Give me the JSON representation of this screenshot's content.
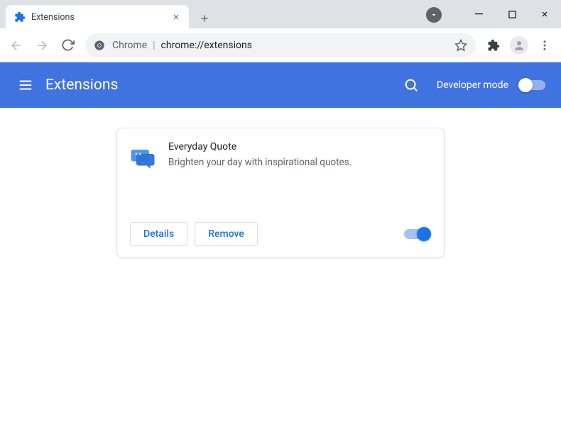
{
  "tab": {
    "title": "Extensions"
  },
  "omnibox": {
    "prefix": "Chrome",
    "url": "chrome://extensions"
  },
  "header": {
    "title": "Extensions",
    "dev_mode": "Developer mode"
  },
  "extension": {
    "name": "Everyday Quote",
    "description": "Brighten your day with inspirational quotes.",
    "details_label": "Details",
    "remove_label": "Remove"
  }
}
